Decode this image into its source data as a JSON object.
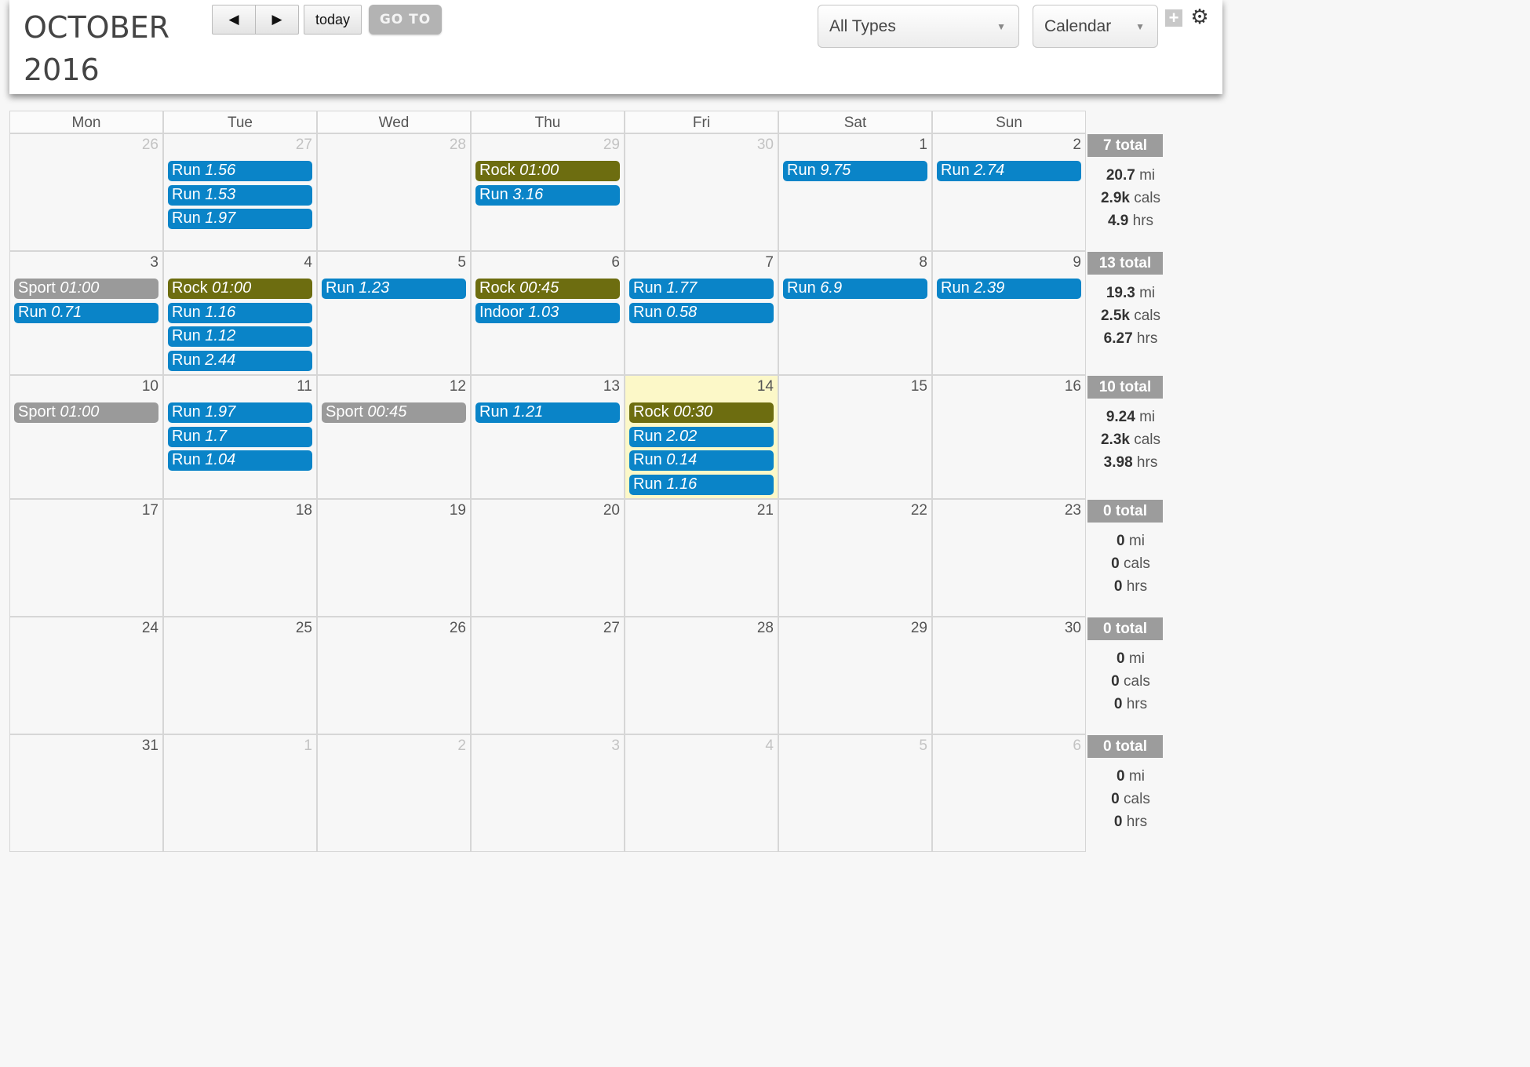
{
  "header": {
    "month": "OCTOBER",
    "year": "2016",
    "prev_icon": "◀",
    "next_icon": "▶",
    "today_label": "today",
    "goto_label": "GO TO",
    "type_filter": "All Types",
    "view_select": "Calendar",
    "add_icon": "+",
    "settings_icon": "⚙"
  },
  "colors": {
    "run": "#0a84c8",
    "rock": "#6d6d10",
    "sport": "#9a9a9a",
    "indoor": "#0a84c8",
    "today_highlight": "#fcf8c8"
  },
  "weekdays": [
    "Mon",
    "Tue",
    "Wed",
    "Thu",
    "Fri",
    "Sat",
    "Sun"
  ],
  "weeks": [
    {
      "days": [
        {
          "num": "26",
          "other": true,
          "events": []
        },
        {
          "num": "27",
          "other": true,
          "events": [
            {
              "type": "Run",
              "value": "1.56",
              "kind": "run"
            },
            {
              "type": "Run",
              "value": "1.53",
              "kind": "run"
            },
            {
              "type": "Run",
              "value": "1.97",
              "kind": "run"
            }
          ]
        },
        {
          "num": "28",
          "other": true,
          "events": []
        },
        {
          "num": "29",
          "other": true,
          "events": [
            {
              "type": "Rock",
              "value": "01:00",
              "kind": "rock"
            },
            {
              "type": "Run",
              "value": "3.16",
              "kind": "run"
            }
          ]
        },
        {
          "num": "30",
          "other": true,
          "events": []
        },
        {
          "num": "1",
          "events": [
            {
              "type": "Run",
              "value": "9.75",
              "kind": "run"
            }
          ]
        },
        {
          "num": "2",
          "events": [
            {
              "type": "Run",
              "value": "2.74",
              "kind": "run"
            }
          ]
        }
      ],
      "total": {
        "label": "7 total",
        "mi": "20.7",
        "cals": "2.9k",
        "hrs": "4.9"
      }
    },
    {
      "days": [
        {
          "num": "3",
          "events": [
            {
              "type": "Sport",
              "value": "01:00",
              "kind": "sport"
            },
            {
              "type": "Run",
              "value": "0.71",
              "kind": "run"
            }
          ]
        },
        {
          "num": "4",
          "events": [
            {
              "type": "Rock",
              "value": "01:00",
              "kind": "rock"
            },
            {
              "type": "Run",
              "value": "1.16",
              "kind": "run"
            },
            {
              "type": "Run",
              "value": "1.12",
              "kind": "run"
            },
            {
              "type": "Run",
              "value": "2.44",
              "kind": "run"
            }
          ]
        },
        {
          "num": "5",
          "events": [
            {
              "type": "Run",
              "value": "1.23",
              "kind": "run"
            }
          ]
        },
        {
          "num": "6",
          "events": [
            {
              "type": "Rock",
              "value": "00:45",
              "kind": "rock"
            },
            {
              "type": "Indoor",
              "value": "1.03",
              "kind": "indoor"
            }
          ]
        },
        {
          "num": "7",
          "events": [
            {
              "type": "Run",
              "value": "1.77",
              "kind": "run"
            },
            {
              "type": "Run",
              "value": "0.58",
              "kind": "run"
            }
          ]
        },
        {
          "num": "8",
          "events": [
            {
              "type": "Run",
              "value": "6.9",
              "kind": "run"
            }
          ]
        },
        {
          "num": "9",
          "events": [
            {
              "type": "Run",
              "value": "2.39",
              "kind": "run"
            }
          ]
        }
      ],
      "total": {
        "label": "13 total",
        "mi": "19.3",
        "cals": "2.5k",
        "hrs": "6.27"
      }
    },
    {
      "days": [
        {
          "num": "10",
          "events": [
            {
              "type": "Sport",
              "value": "01:00",
              "kind": "sport"
            }
          ]
        },
        {
          "num": "11",
          "events": [
            {
              "type": "Run",
              "value": "1.97",
              "kind": "run"
            },
            {
              "type": "Run",
              "value": "1.7",
              "kind": "run"
            },
            {
              "type": "Run",
              "value": "1.04",
              "kind": "run"
            }
          ]
        },
        {
          "num": "12",
          "events": [
            {
              "type": "Sport",
              "value": "00:45",
              "kind": "sport"
            }
          ]
        },
        {
          "num": "13",
          "events": [
            {
              "type": "Run",
              "value": "1.21",
              "kind": "run"
            }
          ]
        },
        {
          "num": "14",
          "today": true,
          "events": [
            {
              "type": "Rock",
              "value": "00:30",
              "kind": "rock"
            },
            {
              "type": "Run",
              "value": "2.02",
              "kind": "run"
            },
            {
              "type": "Run",
              "value": "0.14",
              "kind": "run"
            },
            {
              "type": "Run",
              "value": "1.16",
              "kind": "run"
            }
          ]
        },
        {
          "num": "15",
          "events": []
        },
        {
          "num": "16",
          "events": []
        }
      ],
      "total": {
        "label": "10 total",
        "mi": "9.24",
        "cals": "2.3k",
        "hrs": "3.98"
      }
    },
    {
      "days": [
        {
          "num": "17",
          "events": []
        },
        {
          "num": "18",
          "events": []
        },
        {
          "num": "19",
          "events": []
        },
        {
          "num": "20",
          "events": []
        },
        {
          "num": "21",
          "events": []
        },
        {
          "num": "22",
          "events": []
        },
        {
          "num": "23",
          "events": []
        }
      ],
      "total": {
        "label": "0 total",
        "mi": "0",
        "cals": "0",
        "hrs": "0"
      }
    },
    {
      "days": [
        {
          "num": "24",
          "events": []
        },
        {
          "num": "25",
          "events": []
        },
        {
          "num": "26",
          "events": []
        },
        {
          "num": "27",
          "events": []
        },
        {
          "num": "28",
          "events": []
        },
        {
          "num": "29",
          "events": []
        },
        {
          "num": "30",
          "events": []
        }
      ],
      "total": {
        "label": "0 total",
        "mi": "0",
        "cals": "0",
        "hrs": "0"
      }
    },
    {
      "days": [
        {
          "num": "31",
          "events": []
        },
        {
          "num": "1",
          "other": true,
          "events": []
        },
        {
          "num": "2",
          "other": true,
          "events": []
        },
        {
          "num": "3",
          "other": true,
          "events": []
        },
        {
          "num": "4",
          "other": true,
          "events": []
        },
        {
          "num": "5",
          "other": true,
          "events": []
        },
        {
          "num": "6",
          "other": true,
          "events": []
        }
      ],
      "total": {
        "label": "0 total",
        "mi": "0",
        "cals": "0",
        "hrs": "0"
      }
    }
  ],
  "units": {
    "mi": "mi",
    "cals": "cals",
    "hrs": "hrs"
  }
}
